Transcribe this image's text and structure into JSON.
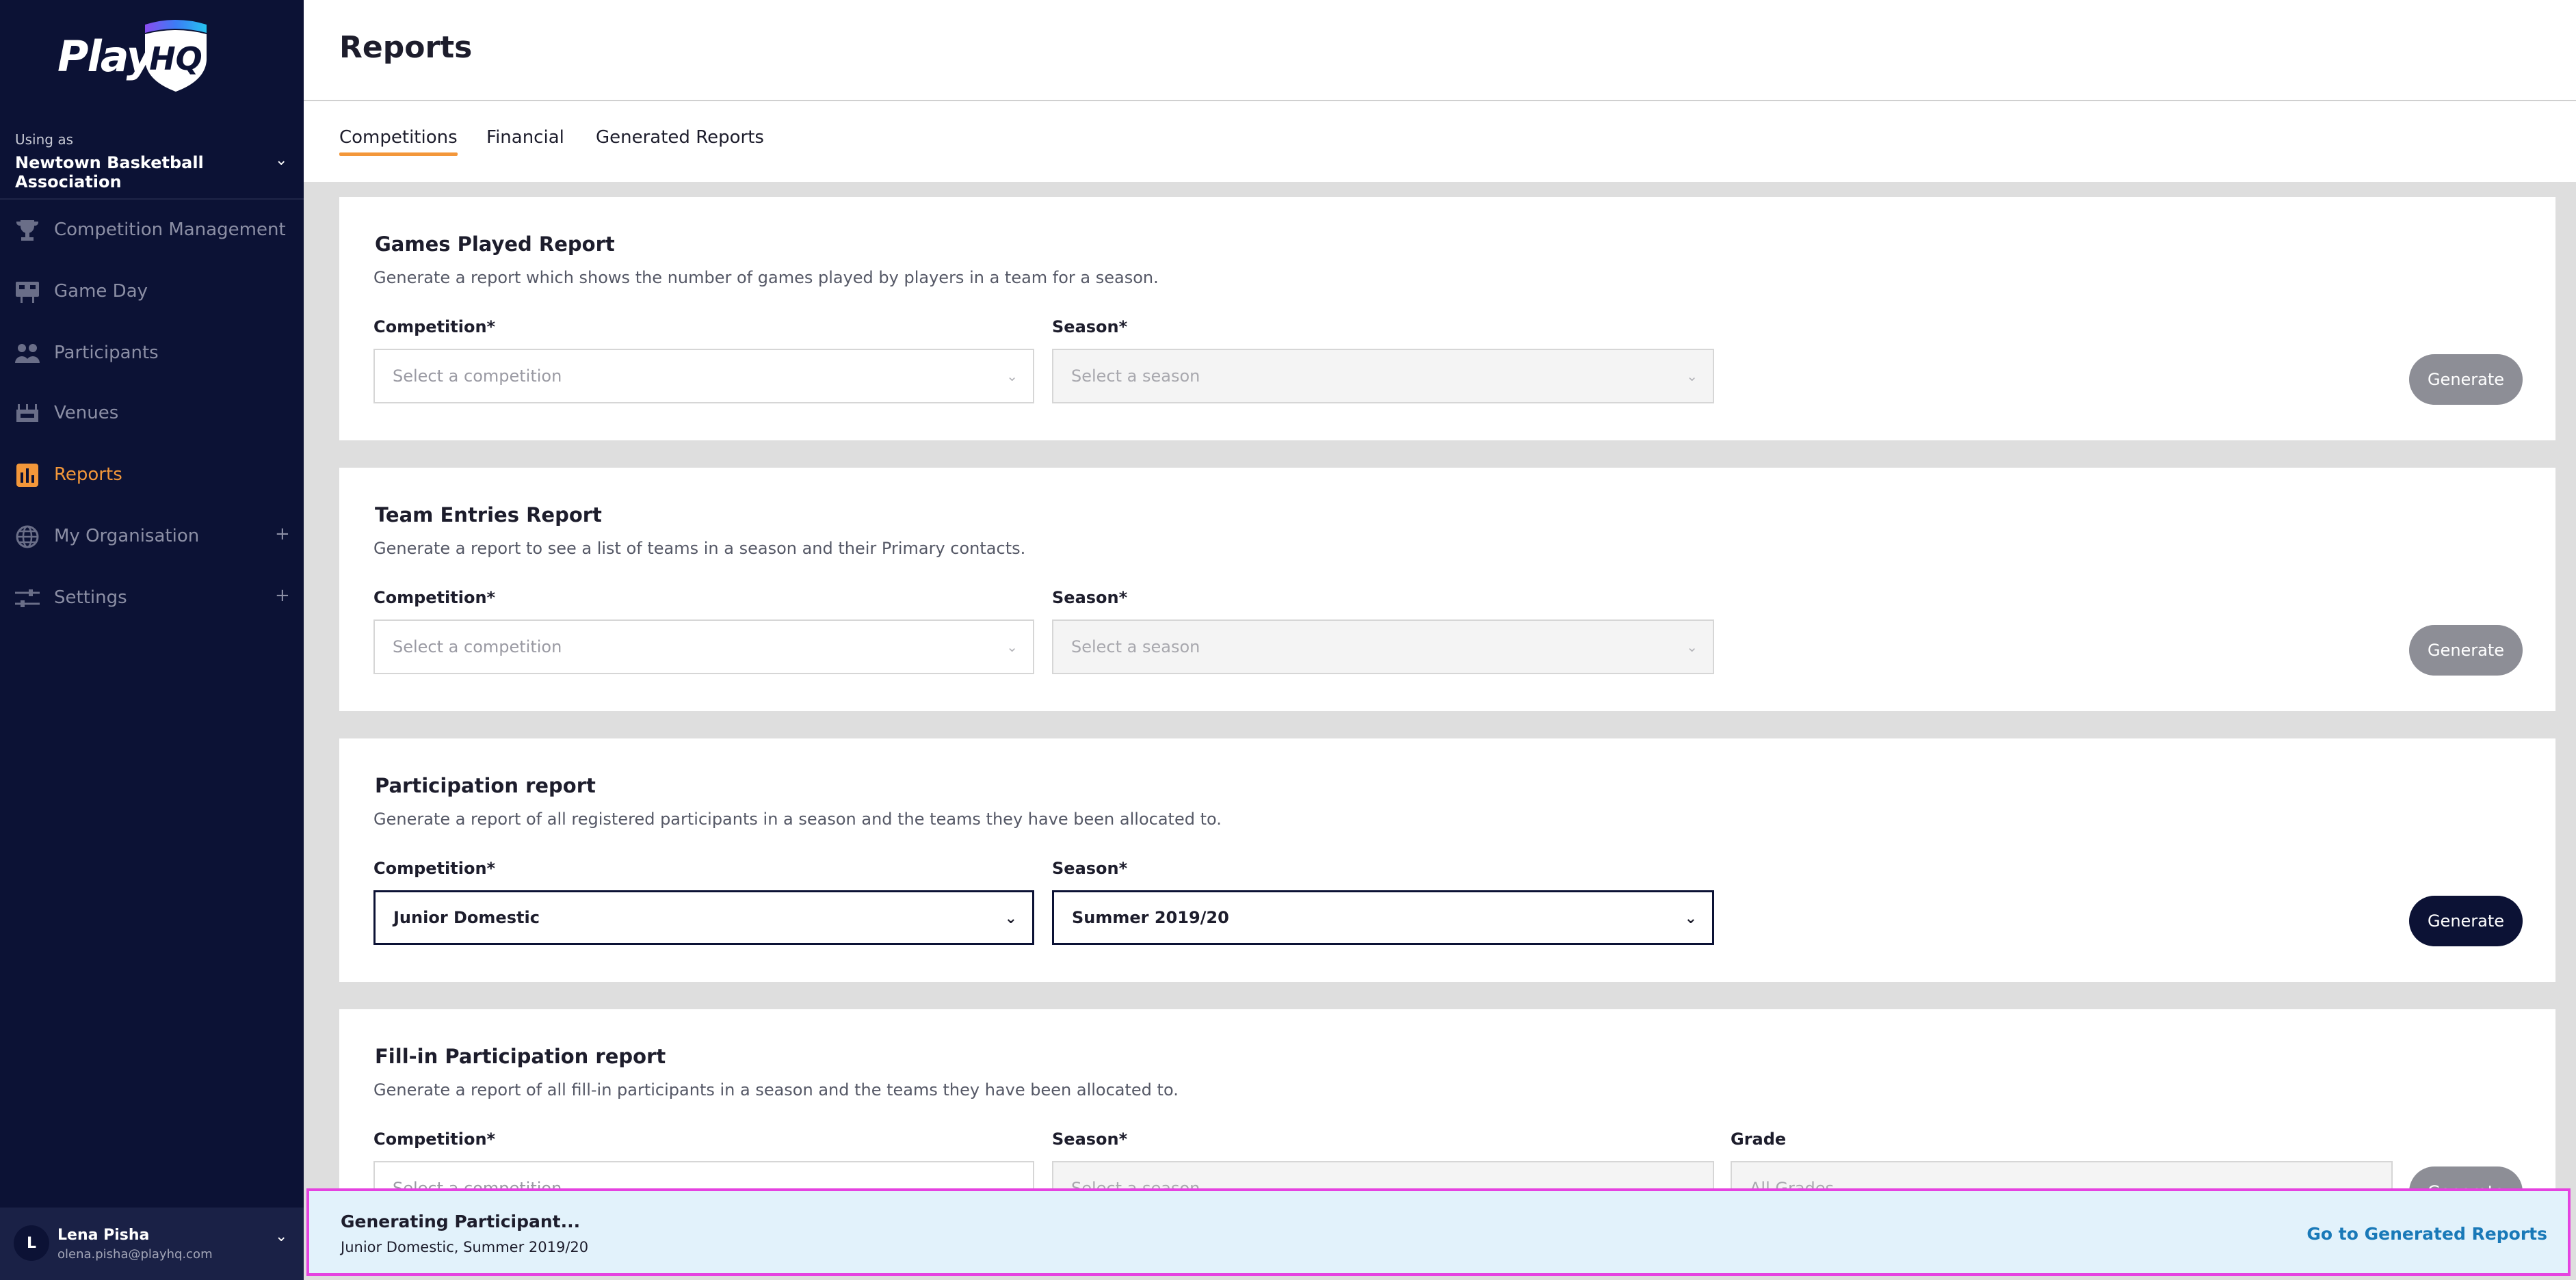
{
  "sidebar": {
    "logo_text": "Play",
    "logo_mark": "HQ",
    "using_as_label": "Using as",
    "org_name": "Newtown Basketball Association",
    "nav": [
      {
        "label": "Competition Management",
        "icon": "trophy-icon"
      },
      {
        "label": "Game Day",
        "icon": "scoreboard-icon"
      },
      {
        "label": "Participants",
        "icon": "participants-icon"
      },
      {
        "label": "Venues",
        "icon": "stadium-icon"
      },
      {
        "label": "Reports",
        "icon": "reports-icon",
        "active": true
      },
      {
        "label": "My Organisation",
        "icon": "globe-icon",
        "expandable": true
      },
      {
        "label": "Settings",
        "icon": "sliders-icon",
        "expandable": true
      }
    ],
    "user": {
      "initial": "L",
      "name": "Lena Pisha",
      "email": "olena.pisha@playhq.com"
    }
  },
  "header": {
    "title": "Reports"
  },
  "tabs": [
    {
      "label": "Competitions",
      "active": true
    },
    {
      "label": "Financial"
    },
    {
      "label": "Generated Reports"
    }
  ],
  "cards": [
    {
      "title": "Games Played Report",
      "description": "Generate a report which shows the number of games played by players in a team for a season.",
      "competition_label": "Competition*",
      "competition_value": "Select a competition",
      "season_label": "Season*",
      "season_value": "Select a season",
      "button": "Generate"
    },
    {
      "title": "Team Entries Report",
      "description": "Generate a report to see a list of teams in a season and their Primary contacts.",
      "competition_label": "Competition*",
      "competition_value": "Select a competition",
      "season_label": "Season*",
      "season_value": "Select a season",
      "button": "Generate"
    },
    {
      "title": "Participation report",
      "description": "Generate a report of all registered participants in a season and the teams they have been allocated to.",
      "competition_label": "Competition*",
      "competition_value": "Junior Domestic",
      "season_label": "Season*",
      "season_value": "Summer 2019/20",
      "button": "Generate"
    },
    {
      "title": "Fill-in Participation report",
      "description": "Generate a report of all fill-in participants in a season and the teams they have been allocated to.",
      "competition_label": "Competition*",
      "competition_value": "Select a competition",
      "season_label": "Season*",
      "season_value": "Select a season",
      "grade_label": "Grade",
      "grade_value": "All Grades",
      "button": "Generate"
    }
  ],
  "toast": {
    "title": "Generating Participant...",
    "subtitle": "Junior Domestic, Summer 2019/20",
    "link": "Go to Generated Reports"
  },
  "colors": {
    "sidebar_bg": "#0c1235",
    "accent": "#f3973a",
    "toast_bg": "#e2f2fb",
    "toast_border": "#e542e0",
    "link": "#1979b8"
  }
}
